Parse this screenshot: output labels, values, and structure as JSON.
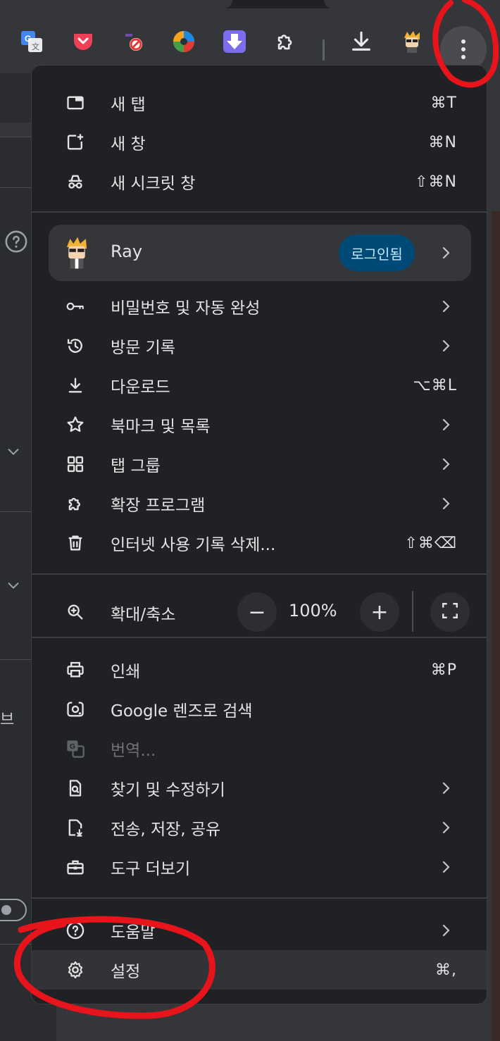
{
  "toolbar": {
    "extensions": [
      "google-translate-icon",
      "pocket-icon",
      "blocker-icon",
      "colorful-wheel-icon",
      "download-arrow-icon",
      "puzzle-icon",
      "download-icon",
      "profile-avatar-icon"
    ],
    "menu_icon": "kebab-menu-icon"
  },
  "page": {
    "side_text": "브"
  },
  "menu": {
    "top_items": [
      {
        "label": "새 탭",
        "shortcut": "⌘T",
        "icon": "new-tab-icon"
      },
      {
        "label": "새 창",
        "shortcut": "⌘N",
        "icon": "new-window-icon"
      },
      {
        "label": "새 시크릿 창",
        "shortcut": "⇧⌘N",
        "icon": "incognito-icon"
      }
    ],
    "profile": {
      "name": "Ray",
      "badge": "로그인됨"
    },
    "mid_items": [
      {
        "label": "비밀번호 및 자동 완성",
        "shortcut": "",
        "icon": "key-icon",
        "submenu": true
      },
      {
        "label": "방문 기록",
        "shortcut": "",
        "icon": "history-icon",
        "submenu": true
      },
      {
        "label": "다운로드",
        "shortcut": "⌥⌘L",
        "icon": "download-icon",
        "submenu": false
      },
      {
        "label": "북마크 및 목록",
        "shortcut": "",
        "icon": "star-icon",
        "submenu": true
      },
      {
        "label": "탭 그룹",
        "shortcut": "",
        "icon": "tab-groups-icon",
        "submenu": true
      },
      {
        "label": "확장 프로그램",
        "shortcut": "",
        "icon": "puzzle-icon",
        "submenu": true
      },
      {
        "label": "인터넷 사용 기록 삭제...",
        "shortcut": "⇧⌘⌫",
        "icon": "trash-icon",
        "submenu": false
      }
    ],
    "zoom": {
      "label": "확대/축소",
      "minus": "−",
      "value": "100%",
      "plus": "+"
    },
    "tool_items": [
      {
        "label": "인쇄",
        "shortcut": "⌘P",
        "icon": "print-icon",
        "submenu": false
      },
      {
        "label": "Google 렌즈로 검색",
        "shortcut": "",
        "icon": "lens-icon",
        "submenu": false
      },
      {
        "label": "번역...",
        "shortcut": "",
        "icon": "translate-icon",
        "submenu": false,
        "disabled": true
      },
      {
        "label": "찾기 및 수정하기",
        "shortcut": "",
        "icon": "find-icon",
        "submenu": true
      },
      {
        "label": "전송, 저장, 공유",
        "shortcut": "",
        "icon": "save-share-icon",
        "submenu": true
      },
      {
        "label": "도구 더보기",
        "shortcut": "",
        "icon": "toolbox-icon",
        "submenu": true
      }
    ],
    "bottom_items": [
      {
        "label": "도움말",
        "shortcut": "",
        "icon": "help-icon",
        "submenu": true
      },
      {
        "label": "설정",
        "shortcut": "⌘,",
        "icon": "gear-icon",
        "submenu": false,
        "highlighted": true
      }
    ]
  },
  "colors": {
    "menu_bg": "#202124",
    "badge_bg": "#004a77",
    "annotation": "#e8141c"
  }
}
